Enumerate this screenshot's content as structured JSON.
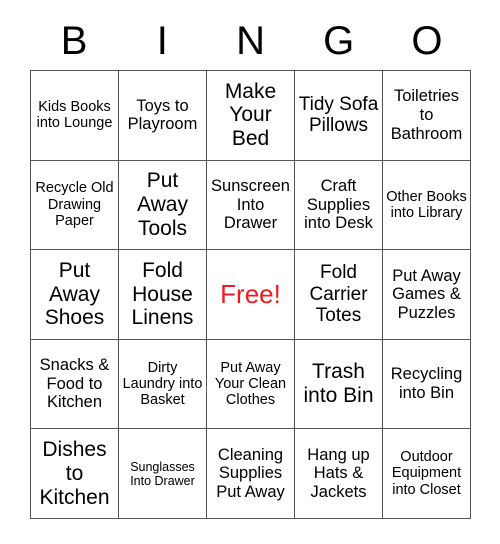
{
  "title": "BINGO",
  "header": {
    "letters": [
      "B",
      "I",
      "N",
      "G",
      "O"
    ]
  },
  "colors": {
    "free_space_text": "#ee1b22",
    "grid_line": "#555555",
    "cell_text": "#000000",
    "background": "#ffffff"
  },
  "grid": {
    "columns": 5,
    "rows": 5,
    "free_space": {
      "row": 3,
      "column": 3,
      "label": "Free!"
    },
    "cells": [
      [
        {
          "text": "Kids Books into Lounge",
          "size": "sm"
        },
        {
          "text": "Toys to Playroom",
          "size": "md"
        },
        {
          "text": "Make Your Bed",
          "size": "xl"
        },
        {
          "text": "Tidy Sofa Pillows",
          "size": "lg"
        },
        {
          "text": "Toiletries to Bathroom",
          "size": "md"
        }
      ],
      [
        {
          "text": "Recycle Old Drawing Paper",
          "size": "sm"
        },
        {
          "text": "Put Away Tools",
          "size": "xl"
        },
        {
          "text": "Sunscreen Into Drawer",
          "size": "md"
        },
        {
          "text": "Craft Supplies into Desk",
          "size": "md"
        },
        {
          "text": "Other Books into Library",
          "size": "sm"
        }
      ],
      [
        {
          "text": "Put Away Shoes",
          "size": "xl"
        },
        {
          "text": "Fold House Linens",
          "size": "xl"
        },
        {
          "text": "Free!",
          "size": "free"
        },
        {
          "text": "Fold Carrier Totes",
          "size": "lg"
        },
        {
          "text": "Put Away Games & Puzzles",
          "size": "md"
        }
      ],
      [
        {
          "text": "Snacks & Food to Kitchen",
          "size": "md"
        },
        {
          "text": "Dirty Laundry into Basket",
          "size": "sm"
        },
        {
          "text": "Put Away Your Clean Clothes",
          "size": "sm"
        },
        {
          "text": "Trash into Bin",
          "size": "xl"
        },
        {
          "text": "Recycling into Bin",
          "size": "md"
        }
      ],
      [
        {
          "text": "Dishes to Kitchen",
          "size": "xl"
        },
        {
          "text": "Sunglasses Into Drawer",
          "size": "xs"
        },
        {
          "text": "Cleaning Supplies Put Away",
          "size": "md"
        },
        {
          "text": "Hang up Hats & Jackets",
          "size": "md"
        },
        {
          "text": "Outdoor Equipment into Closet",
          "size": "sm"
        }
      ]
    ]
  }
}
